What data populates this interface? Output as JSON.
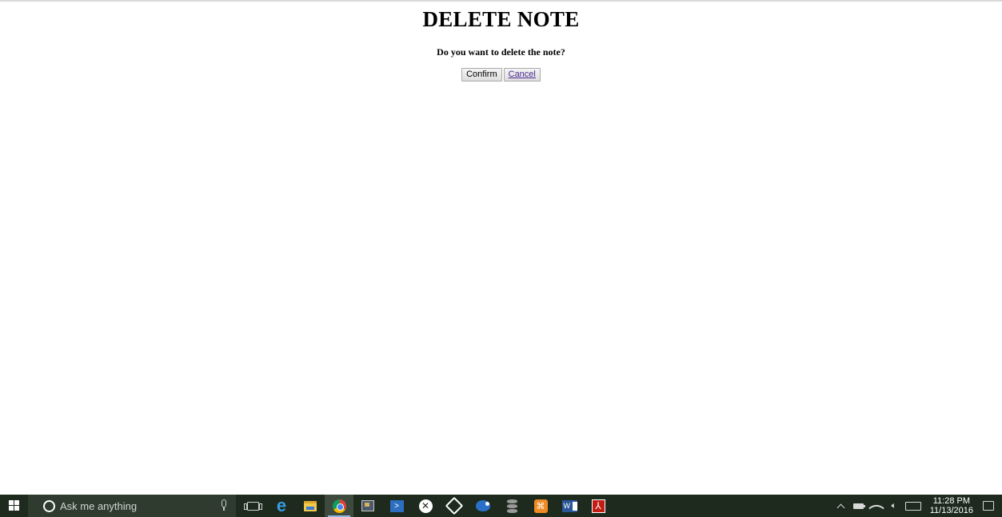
{
  "page": {
    "title": "DELETE NOTE",
    "prompt": "Do you want to delete the note?",
    "confirm_label": "Confirm",
    "cancel_label": "Cancel"
  },
  "taskbar": {
    "search_placeholder": "Ask me anything",
    "apps": [
      {
        "icon": "task-view-icon"
      },
      {
        "icon": "edge-icon"
      },
      {
        "icon": "file-explorer-icon"
      },
      {
        "icon": "chrome-icon",
        "active": true
      },
      {
        "icon": "photos-icon"
      },
      {
        "icon": "powershell-icon"
      },
      {
        "icon": "xbox-icon"
      },
      {
        "icon": "virtualbox-icon"
      },
      {
        "icon": "steam-icon"
      },
      {
        "icon": "database-icon"
      },
      {
        "icon": "xampp-icon"
      },
      {
        "icon": "word-icon",
        "glyph": "W"
      },
      {
        "icon": "acrobat-icon"
      }
    ],
    "tray": {
      "time": "11:28 PM",
      "date": "11/13/2016"
    }
  },
  "colors": {
    "taskbar_bg": "#1d2a1d",
    "search_bg": "#2f3b2f",
    "link_purple": "#4b2a92"
  }
}
